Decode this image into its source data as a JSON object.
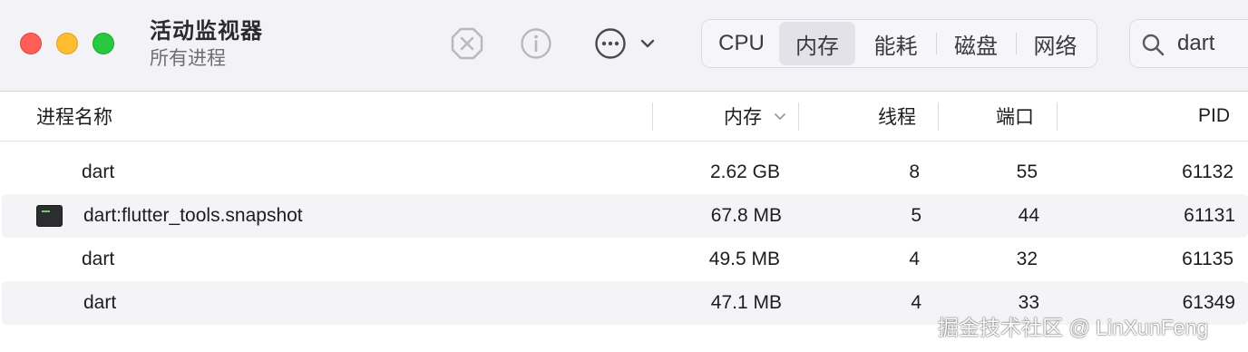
{
  "window": {
    "title": "活动监视器",
    "subtitle": "所有进程"
  },
  "toolbar": {
    "icons": [
      "stop-process-icon",
      "info-icon",
      "more-options-icon",
      "chevron-down-icon"
    ],
    "tabs": [
      {
        "label": "CPU",
        "active": false
      },
      {
        "label": "内存",
        "active": true
      },
      {
        "label": "能耗",
        "active": false
      },
      {
        "label": "磁盘",
        "active": false
      },
      {
        "label": "网络",
        "active": false
      }
    ],
    "search": {
      "value": "dart",
      "icon": "search-icon"
    }
  },
  "table": {
    "columns": {
      "name": "进程名称",
      "memory": "内存",
      "threads": "线程",
      "ports": "端口",
      "pid": "PID"
    },
    "sort": {
      "column": "memory",
      "direction": "descending"
    },
    "rows": [
      {
        "name": "dart",
        "memory": "2.62 GB",
        "threads": "8",
        "ports": "55",
        "pid": "61132",
        "icon": ""
      },
      {
        "name": "dart:flutter_tools.snapshot",
        "memory": "67.8 MB",
        "threads": "5",
        "ports": "44",
        "pid": "61131",
        "icon": "terminal-icon"
      },
      {
        "name": "dart",
        "memory": "49.5 MB",
        "threads": "4",
        "ports": "32",
        "pid": "61135",
        "icon": ""
      },
      {
        "name": "dart",
        "memory": "47.1 MB",
        "threads": "4",
        "ports": "33",
        "pid": "61349",
        "icon": ""
      }
    ]
  },
  "watermark": "掘金技术社区 @ LinXunFeng",
  "colors": {
    "toolbar_bg": "#f3f2f7",
    "traffic_red": "#ff5f57",
    "traffic_yellow": "#febc2e",
    "traffic_green": "#28c840",
    "row_alt_bg": "#f4f4f6",
    "active_tab_bg": "#e3e2e8"
  }
}
